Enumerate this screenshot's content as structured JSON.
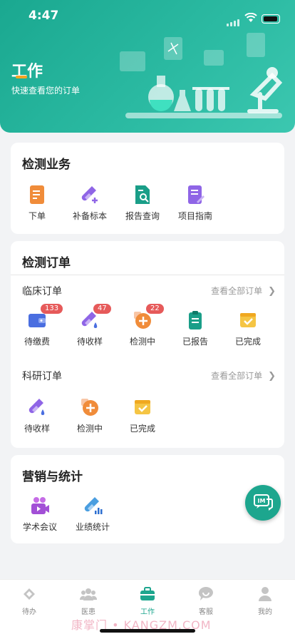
{
  "status": {
    "time": "4:47"
  },
  "header": {
    "title": "工作",
    "subtitle": "快速查看您的订单"
  },
  "services": {
    "title": "检测业务",
    "items": [
      {
        "label": "下单",
        "icon": "order-doc-icon"
      },
      {
        "label": "补备标本",
        "icon": "test-tube-add-icon"
      },
      {
        "label": "报告查询",
        "icon": "report-search-icon"
      },
      {
        "label": "项目指南",
        "icon": "guide-doc-icon"
      }
    ]
  },
  "orders": {
    "title": "检测订单",
    "clinical": {
      "title": "临床订单",
      "see_all": "查看全部订单",
      "items": [
        {
          "label": "待缴费",
          "badge": "133",
          "icon": "wallet-icon"
        },
        {
          "label": "待收样",
          "badge": "47",
          "icon": "test-tube-drop-icon"
        },
        {
          "label": "检测中",
          "badge": "22",
          "icon": "plus-circle-icon"
        },
        {
          "label": "已报告",
          "badge": "",
          "icon": "clipboard-icon"
        },
        {
          "label": "已完成",
          "badge": "",
          "icon": "check-box-icon"
        }
      ]
    },
    "research": {
      "title": "科研订单",
      "see_all": "查看全部订单",
      "items": [
        {
          "label": "待收样",
          "icon": "test-tube-drop-icon"
        },
        {
          "label": "检测中",
          "icon": "plus-circle-icon"
        },
        {
          "label": "已完成",
          "icon": "check-box-icon"
        }
      ]
    }
  },
  "marketing": {
    "title": "营销与统计",
    "items": [
      {
        "label": "学术会议",
        "icon": "video-meeting-icon"
      },
      {
        "label": "业绩统计",
        "icon": "stats-tube-icon"
      }
    ]
  },
  "float_button": {
    "label": "IM"
  },
  "tabbar": [
    {
      "label": "待办",
      "icon": "todo-icon"
    },
    {
      "label": "医患",
      "icon": "people-icon"
    },
    {
      "label": "工作",
      "icon": "briefcase-icon",
      "active": true
    },
    {
      "label": "客服",
      "icon": "support-icon"
    },
    {
      "label": "我的",
      "icon": "user-icon"
    }
  ],
  "watermark": "康掌门 • KANGZM.COM",
  "colors": {
    "primary": "#1da68e",
    "badge": "#e65a5a",
    "orange": "#f08c3a",
    "yellow": "#f5c544",
    "purple": "#8f65e6",
    "blue": "#4a6ee0"
  }
}
